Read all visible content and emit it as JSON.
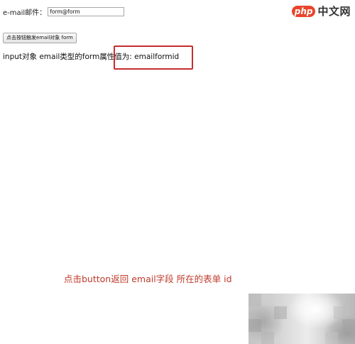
{
  "form": {
    "email_label": "e-mail邮件：",
    "email_value": "form@form",
    "button_label": "点击按钮触发email对象 form"
  },
  "result": {
    "text": "input对象 email类型的form属性值为: emailformid"
  },
  "annotation": {
    "text": "点击button返回 email字段 所在的表单 id"
  },
  "watermark": {
    "badge": "php",
    "text": "中文网"
  },
  "colors": {
    "highlight_border": "#c62e2e",
    "annotation_text": "#c0392b",
    "watermark_badge": "#e8452c"
  }
}
